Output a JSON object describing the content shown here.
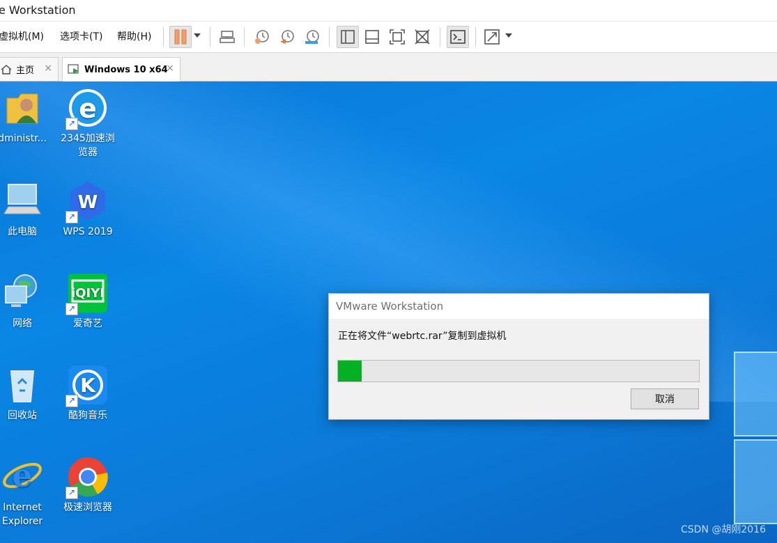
{
  "window": {
    "title": "e Workstation"
  },
  "menu": [
    {
      "label": "虚拟机(M)"
    },
    {
      "label": "选项卡(T)"
    },
    {
      "label": "帮助(H)"
    }
  ],
  "tabs": [
    {
      "label": "主页",
      "close": "×"
    },
    {
      "label": "Windows 10 x64",
      "close": "×"
    }
  ],
  "desktop_icons": [
    {
      "label": "Administrator",
      "display": "dministr..."
    },
    {
      "label": "2345加速浏览器",
      "display": "2345加速浏览器"
    },
    {
      "label": "此电脑"
    },
    {
      "label": "WPS 2019"
    },
    {
      "label": "网络"
    },
    {
      "label": "爱奇艺"
    },
    {
      "label": "回收站"
    },
    {
      "label": "酷狗音乐"
    },
    {
      "label": "Internet Explorer"
    },
    {
      "label": "极速浏览器"
    }
  ],
  "dialog": {
    "title": "VMware Workstation",
    "message": "正在将文件“webrtc.rar”复制到虚拟机",
    "progress_fraction": 0.065,
    "cancel_label": "取消"
  },
  "watermark": "CSDN @胡刚2016",
  "colors": {
    "desktop": "#0a78d8",
    "progress": "#06b025"
  }
}
